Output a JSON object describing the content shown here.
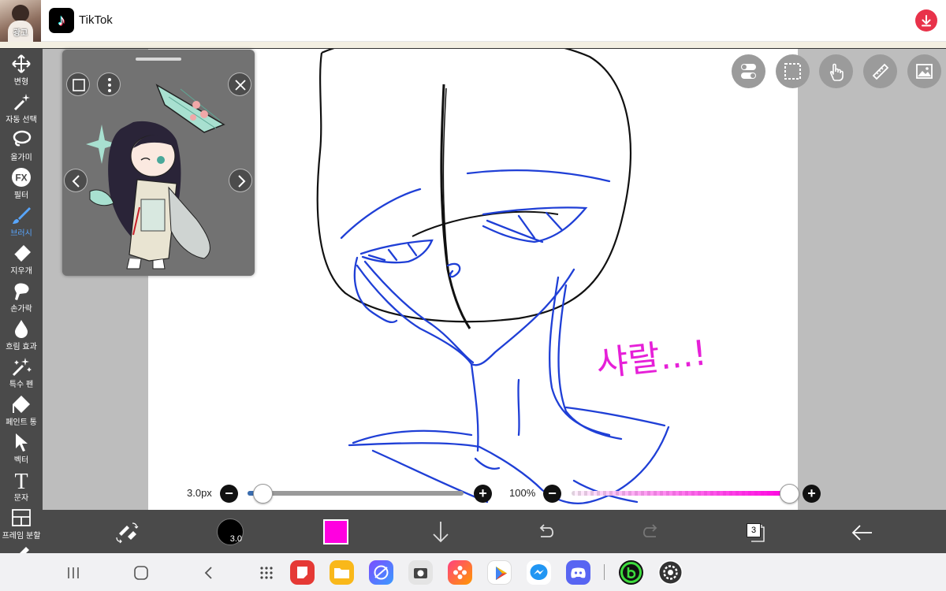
{
  "ad": {
    "thumb_caption": "광고",
    "app_name": "TikTok"
  },
  "toolbar": {
    "tools": [
      {
        "label": "변형",
        "icon": "move-icon"
      },
      {
        "label": "자동 선택",
        "icon": "magic-wand-icon"
      },
      {
        "label": "올가미",
        "icon": "lasso-icon"
      },
      {
        "label": "필터",
        "icon": "fx-icon"
      },
      {
        "label": "브러시",
        "icon": "brush-icon",
        "active": true
      },
      {
        "label": "지우개",
        "icon": "eraser-icon"
      },
      {
        "label": "손가락",
        "icon": "finger-icon"
      },
      {
        "label": "흐림 효과",
        "icon": "blur-icon"
      },
      {
        "label": "특수 펜",
        "icon": "special-pen-icon"
      },
      {
        "label": "페인트 통",
        "icon": "paint-bucket-icon"
      },
      {
        "label": "벡터",
        "icon": "vector-icon"
      },
      {
        "label": "문자",
        "icon": "text-icon"
      },
      {
        "label": "프레임 분할",
        "icon": "frame-split-icon"
      }
    ]
  },
  "fx_glyph": "FX",
  "text_glyph": "T",
  "sliders": {
    "brush_size_label": "3.0px",
    "brush_size_value": 0.07,
    "opacity_label": "100%",
    "opacity_value": 1.0,
    "minus_glyph": "−",
    "plus_glyph": "+"
  },
  "bottombar": {
    "brush_size_badge": "3.0",
    "current_color": "#ff00e0",
    "layer_count": "3"
  },
  "canvas_text": "샤랄...!",
  "colors": {
    "toolbar_bg": "#4a4a4a",
    "active_tool": "#58a6ff",
    "sketch_blue": "#1f3fd6",
    "sketch_black": "#111111",
    "sketch_pink": "#e620d8",
    "opacity_pink": "#ff00e0"
  }
}
